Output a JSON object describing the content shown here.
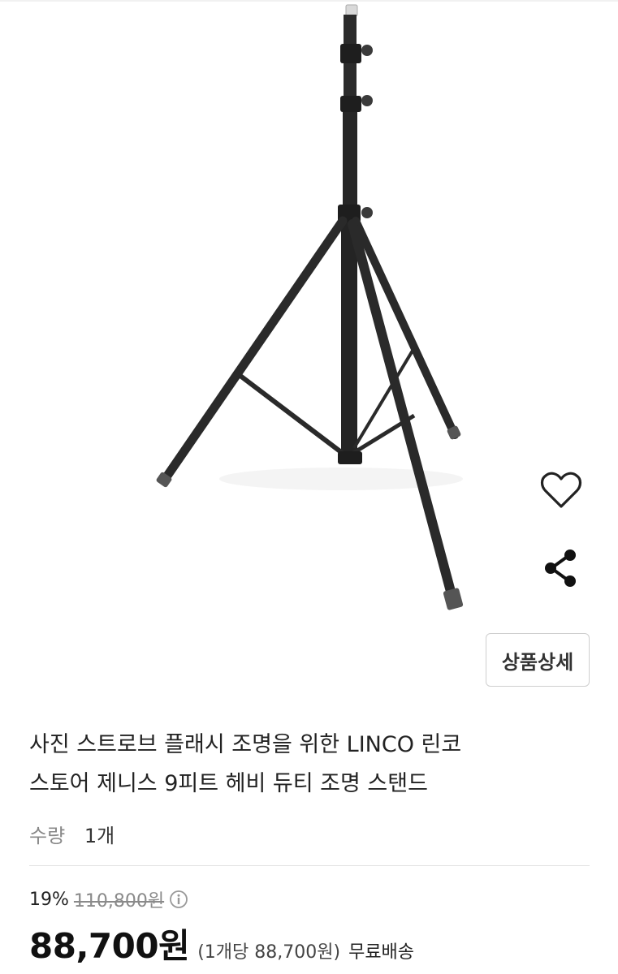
{
  "product": {
    "title_line1": "사진 스트로브 플래시 조명을 위한 LINCO 린코",
    "title_line2": "스토어 제니스 9피트 헤비 듀티 조명 스탠드",
    "image_icon": "light-stand-tripod"
  },
  "actions": {
    "wishlist_icon": "heart-outline-icon",
    "share_icon": "share-icon",
    "detail_label": "상품상세"
  },
  "quantity": {
    "label": "수량",
    "value": "1개"
  },
  "pricing": {
    "discount_rate": "19%",
    "original_price": "110,800원",
    "sale_price": "88,700원",
    "unit_price": "(1개당 88,700원)",
    "shipping": "무료배송",
    "info_icon": "info-icon"
  },
  "colors": {
    "stand": "#2a2a2a",
    "text_primary": "#222222",
    "text_muted": "#888888"
  }
}
